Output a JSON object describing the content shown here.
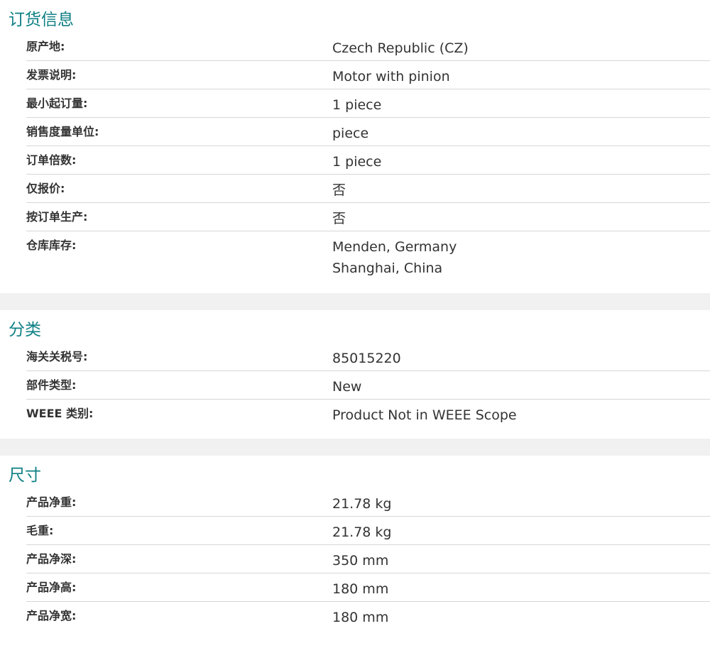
{
  "sections": [
    {
      "title": "订货信息",
      "rows": [
        {
          "label": "原产地:",
          "value": "Czech Republic (CZ)"
        },
        {
          "label": "发票说明:",
          "value": "Motor with pinion"
        },
        {
          "label": "最小起订量:",
          "value": "1 piece"
        },
        {
          "label": "销售度量单位:",
          "value": "piece"
        },
        {
          "label": "订单倍数:",
          "value": "1 piece"
        },
        {
          "label": "仅报价:",
          "value": "否"
        },
        {
          "label": "按订单生产:",
          "value": "否"
        },
        {
          "label": "仓库库存:",
          "values": [
            "Menden, Germany",
            "Shanghai, China"
          ]
        }
      ]
    },
    {
      "title": "分类",
      "rows": [
        {
          "label": "海关关税号:",
          "value": "85015220"
        },
        {
          "label": "部件类型:",
          "value": "New"
        },
        {
          "label": "WEEE 类别:",
          "value": "Product Not in WEEE Scope"
        }
      ]
    },
    {
      "title": "尺寸",
      "rows": [
        {
          "label": "产品净重:",
          "value": "21.78 kg"
        },
        {
          "label": "毛重:",
          "value": "21.78 kg"
        },
        {
          "label": "产品净深:",
          "value": "350 mm"
        },
        {
          "label": "产品净高:",
          "value": "180 mm"
        },
        {
          "label": "产品净宽:",
          "value": "180 mm"
        }
      ]
    }
  ],
  "colors": {
    "heading": "#0e7f84",
    "divider": "#d6d6d6",
    "gap": "#f1f1f1"
  }
}
